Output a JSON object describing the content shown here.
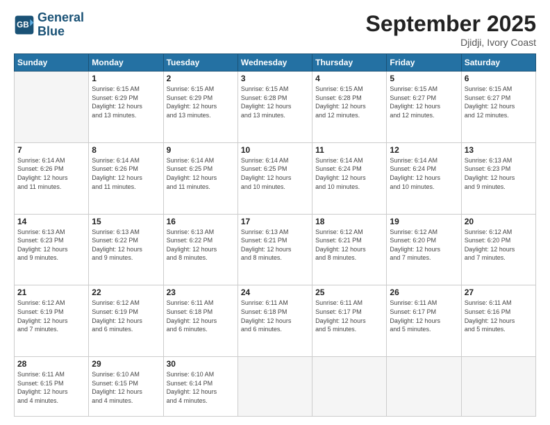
{
  "logo": {
    "line1": "General",
    "line2": "Blue"
  },
  "title": "September 2025",
  "location": "Djidji, Ivory Coast",
  "days_header": [
    "Sunday",
    "Monday",
    "Tuesday",
    "Wednesday",
    "Thursday",
    "Friday",
    "Saturday"
  ],
  "weeks": [
    [
      {
        "day": "",
        "info": ""
      },
      {
        "day": "1",
        "info": "Sunrise: 6:15 AM\nSunset: 6:29 PM\nDaylight: 12 hours\nand 13 minutes."
      },
      {
        "day": "2",
        "info": "Sunrise: 6:15 AM\nSunset: 6:29 PM\nDaylight: 12 hours\nand 13 minutes."
      },
      {
        "day": "3",
        "info": "Sunrise: 6:15 AM\nSunset: 6:28 PM\nDaylight: 12 hours\nand 13 minutes."
      },
      {
        "day": "4",
        "info": "Sunrise: 6:15 AM\nSunset: 6:28 PM\nDaylight: 12 hours\nand 12 minutes."
      },
      {
        "day": "5",
        "info": "Sunrise: 6:15 AM\nSunset: 6:27 PM\nDaylight: 12 hours\nand 12 minutes."
      },
      {
        "day": "6",
        "info": "Sunrise: 6:15 AM\nSunset: 6:27 PM\nDaylight: 12 hours\nand 12 minutes."
      }
    ],
    [
      {
        "day": "7",
        "info": "Sunrise: 6:14 AM\nSunset: 6:26 PM\nDaylight: 12 hours\nand 11 minutes."
      },
      {
        "day": "8",
        "info": "Sunrise: 6:14 AM\nSunset: 6:26 PM\nDaylight: 12 hours\nand 11 minutes."
      },
      {
        "day": "9",
        "info": "Sunrise: 6:14 AM\nSunset: 6:25 PM\nDaylight: 12 hours\nand 11 minutes."
      },
      {
        "day": "10",
        "info": "Sunrise: 6:14 AM\nSunset: 6:25 PM\nDaylight: 12 hours\nand 10 minutes."
      },
      {
        "day": "11",
        "info": "Sunrise: 6:14 AM\nSunset: 6:24 PM\nDaylight: 12 hours\nand 10 minutes."
      },
      {
        "day": "12",
        "info": "Sunrise: 6:14 AM\nSunset: 6:24 PM\nDaylight: 12 hours\nand 10 minutes."
      },
      {
        "day": "13",
        "info": "Sunrise: 6:13 AM\nSunset: 6:23 PM\nDaylight: 12 hours\nand 9 minutes."
      }
    ],
    [
      {
        "day": "14",
        "info": "Sunrise: 6:13 AM\nSunset: 6:23 PM\nDaylight: 12 hours\nand 9 minutes."
      },
      {
        "day": "15",
        "info": "Sunrise: 6:13 AM\nSunset: 6:22 PM\nDaylight: 12 hours\nand 9 minutes."
      },
      {
        "day": "16",
        "info": "Sunrise: 6:13 AM\nSunset: 6:22 PM\nDaylight: 12 hours\nand 8 minutes."
      },
      {
        "day": "17",
        "info": "Sunrise: 6:13 AM\nSunset: 6:21 PM\nDaylight: 12 hours\nand 8 minutes."
      },
      {
        "day": "18",
        "info": "Sunrise: 6:12 AM\nSunset: 6:21 PM\nDaylight: 12 hours\nand 8 minutes."
      },
      {
        "day": "19",
        "info": "Sunrise: 6:12 AM\nSunset: 6:20 PM\nDaylight: 12 hours\nand 7 minutes."
      },
      {
        "day": "20",
        "info": "Sunrise: 6:12 AM\nSunset: 6:20 PM\nDaylight: 12 hours\nand 7 minutes."
      }
    ],
    [
      {
        "day": "21",
        "info": "Sunrise: 6:12 AM\nSunset: 6:19 PM\nDaylight: 12 hours\nand 7 minutes."
      },
      {
        "day": "22",
        "info": "Sunrise: 6:12 AM\nSunset: 6:19 PM\nDaylight: 12 hours\nand 6 minutes."
      },
      {
        "day": "23",
        "info": "Sunrise: 6:11 AM\nSunset: 6:18 PM\nDaylight: 12 hours\nand 6 minutes."
      },
      {
        "day": "24",
        "info": "Sunrise: 6:11 AM\nSunset: 6:18 PM\nDaylight: 12 hours\nand 6 minutes."
      },
      {
        "day": "25",
        "info": "Sunrise: 6:11 AM\nSunset: 6:17 PM\nDaylight: 12 hours\nand 5 minutes."
      },
      {
        "day": "26",
        "info": "Sunrise: 6:11 AM\nSunset: 6:17 PM\nDaylight: 12 hours\nand 5 minutes."
      },
      {
        "day": "27",
        "info": "Sunrise: 6:11 AM\nSunset: 6:16 PM\nDaylight: 12 hours\nand 5 minutes."
      }
    ],
    [
      {
        "day": "28",
        "info": "Sunrise: 6:11 AM\nSunset: 6:15 PM\nDaylight: 12 hours\nand 4 minutes."
      },
      {
        "day": "29",
        "info": "Sunrise: 6:10 AM\nSunset: 6:15 PM\nDaylight: 12 hours\nand 4 minutes."
      },
      {
        "day": "30",
        "info": "Sunrise: 6:10 AM\nSunset: 6:14 PM\nDaylight: 12 hours\nand 4 minutes."
      },
      {
        "day": "",
        "info": ""
      },
      {
        "day": "",
        "info": ""
      },
      {
        "day": "",
        "info": ""
      },
      {
        "day": "",
        "info": ""
      }
    ]
  ]
}
